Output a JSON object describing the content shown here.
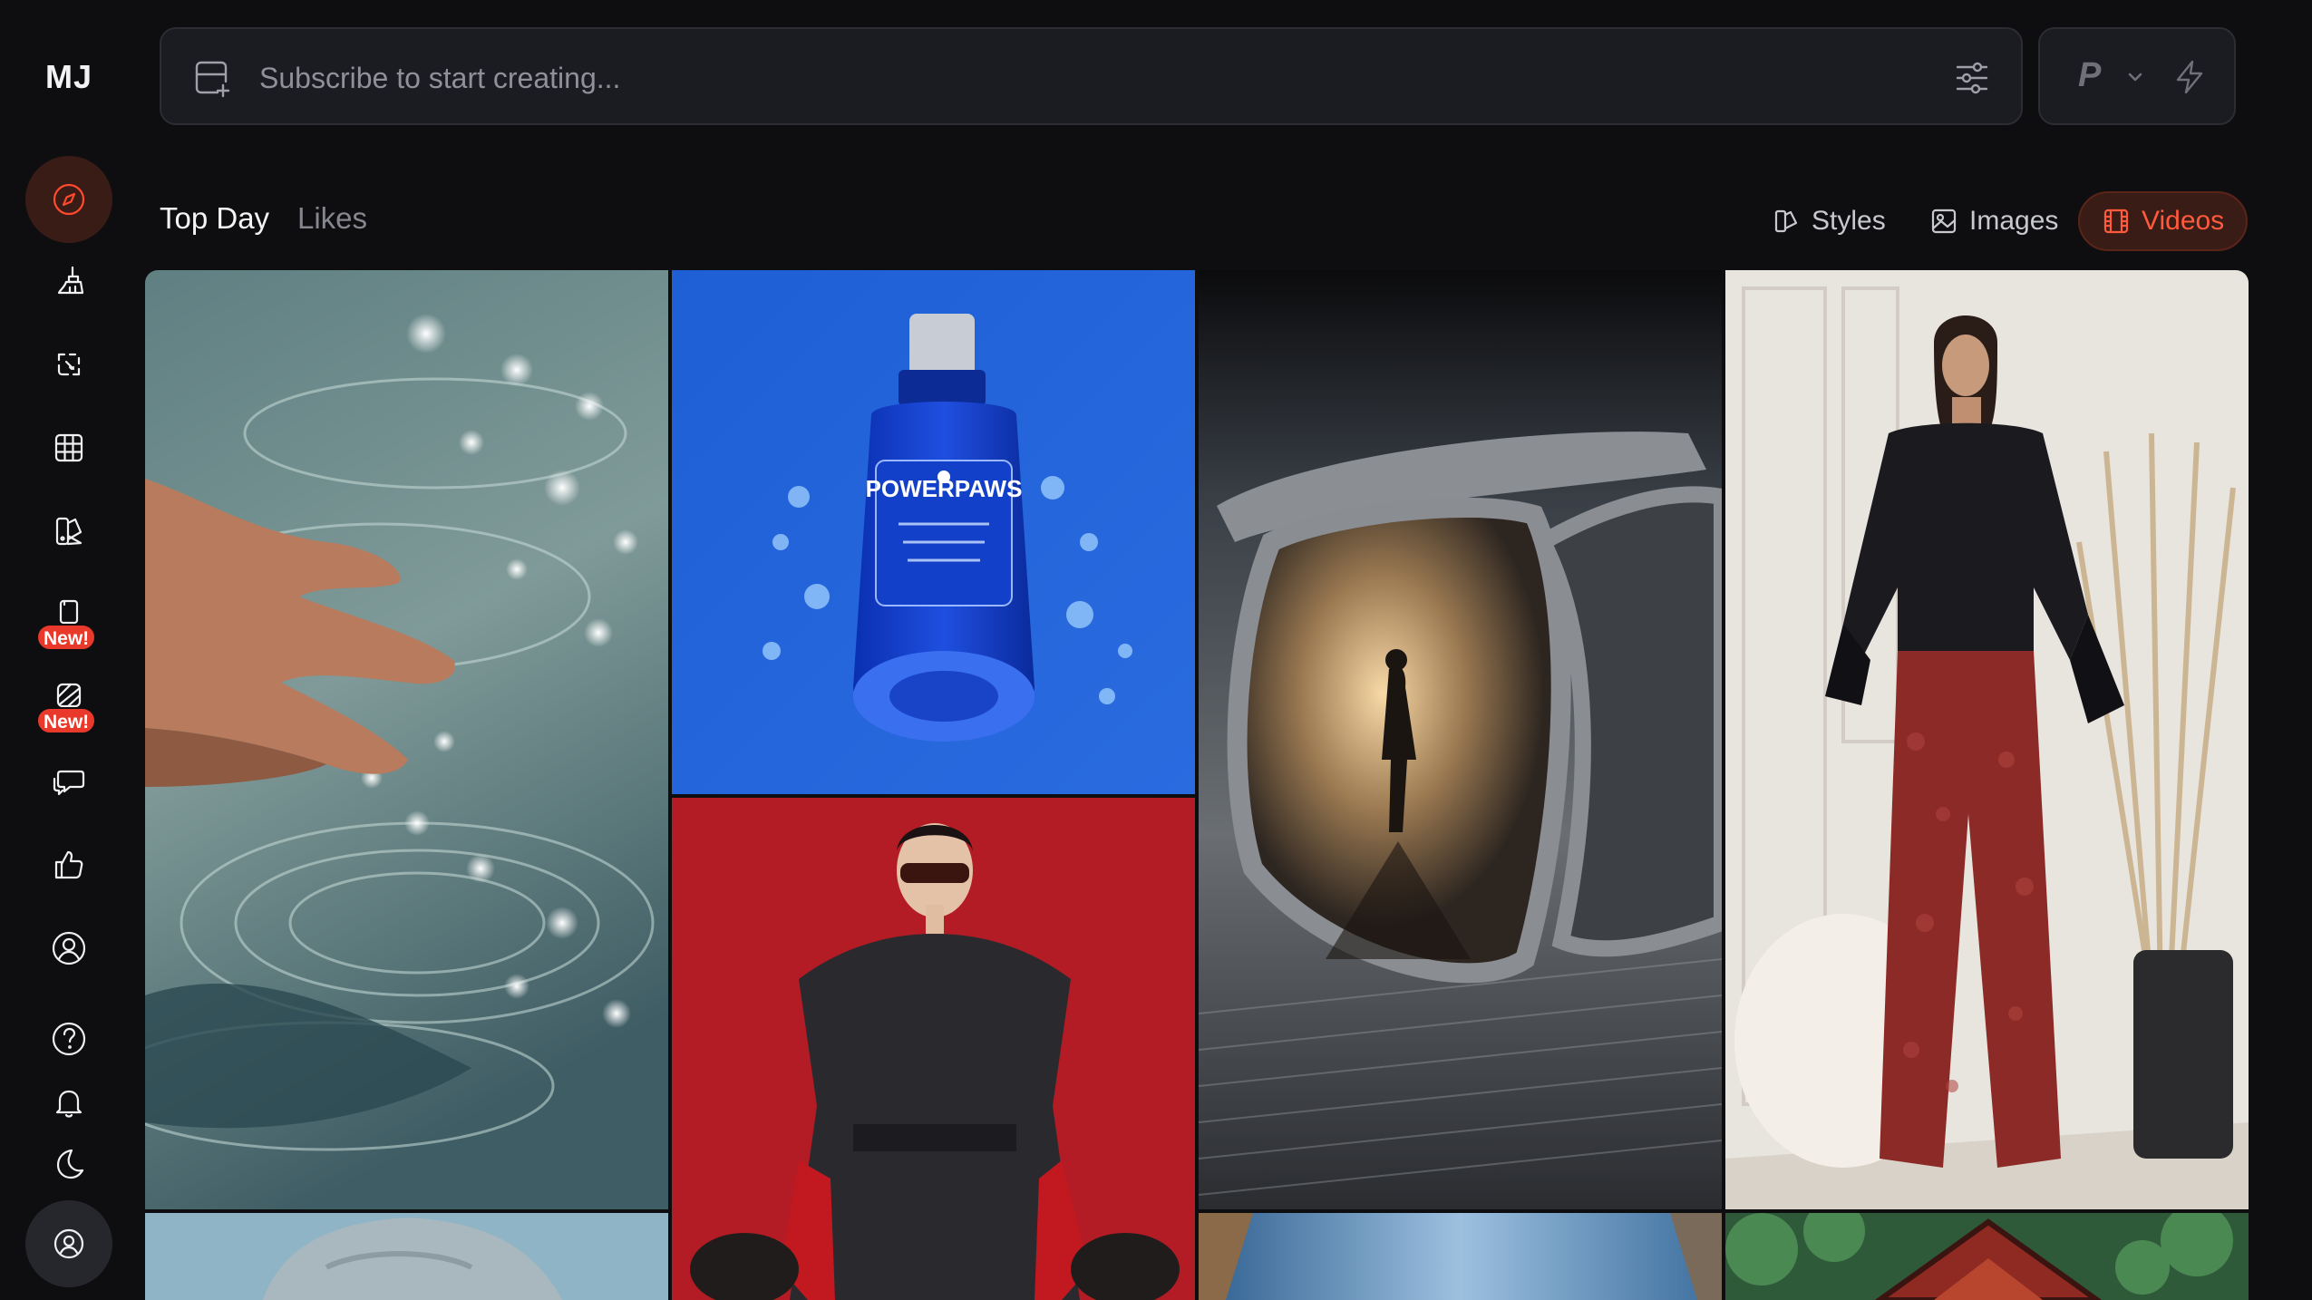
{
  "sidebar": {
    "logo": "MJ",
    "items": [
      {
        "name": "explore",
        "icon": "compass-icon",
        "active": true
      },
      {
        "name": "create",
        "icon": "paintbrush-icon"
      },
      {
        "name": "edit",
        "icon": "edit-frame-icon"
      },
      {
        "name": "organize",
        "icon": "grid-icon"
      },
      {
        "name": "personalize",
        "icon": "palette-icon"
      },
      {
        "name": "moodboards",
        "icon": "cards-icon",
        "badge": "New!"
      },
      {
        "name": "draft",
        "icon": "hatched-square-icon",
        "badge": "New!"
      },
      {
        "name": "chat",
        "icon": "chat-bubbles-icon"
      },
      {
        "name": "likes",
        "icon": "thumbs-up-icon"
      },
      {
        "name": "profile",
        "icon": "user-circle-icon"
      },
      {
        "name": "help",
        "icon": "question-icon"
      },
      {
        "name": "notifications",
        "icon": "bell-icon"
      },
      {
        "name": "theme",
        "icon": "moon-icon"
      },
      {
        "name": "account",
        "icon": "account-icon"
      }
    ]
  },
  "prompt": {
    "placeholder": "Subscribe to start creating...",
    "mode_letter": "P"
  },
  "tabs": [
    {
      "label": "Top Day",
      "active": true
    },
    {
      "label": "Likes",
      "active": false
    }
  ],
  "filters": [
    {
      "label": "Styles",
      "icon": "styles-icon",
      "active": false
    },
    {
      "label": "Images",
      "icon": "image-icon",
      "active": false
    },
    {
      "label": "Videos",
      "icon": "film-icon",
      "active": true
    }
  ],
  "gallery": {
    "bottle_brand": "POWERPAWS"
  },
  "colors": {
    "background": "#0e0e11",
    "accent": "#ff4a2e",
    "accent_bg": "#3a1c16",
    "badge": "#e8392a"
  }
}
